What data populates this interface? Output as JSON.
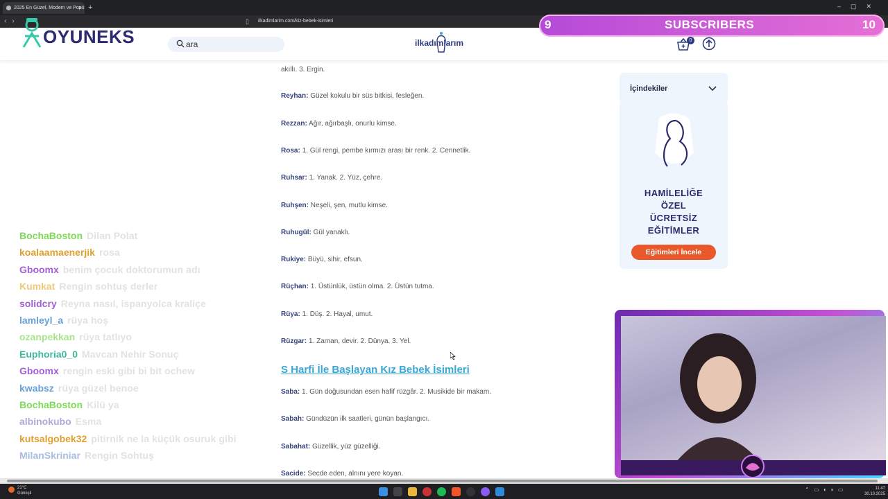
{
  "browser": {
    "tab_title": "2025 En Güzel, Modern ve Popü",
    "tab_close": "×",
    "new_tab": "+",
    "url": "ilkadimlarim.com/kiz-bebek-isimleri"
  },
  "site": {
    "logo": "OYUNEKS",
    "search_value": "ara",
    "center_logo": "ilkadımlarım",
    "cart_count": "0"
  },
  "subscribers": {
    "left_number": "9",
    "label": "SUBSCRIBERS",
    "right_number": "10"
  },
  "content": {
    "top_fragment": "akıllı. 3. Ergin.",
    "entries_r": [
      {
        "name": "Reyhan:",
        "meaning": "Güzel kokulu bir süs bitkisi, fesleğen."
      },
      {
        "name": "Rezzan:",
        "meaning": "Ağır, ağırbaşlı, onurlu kimse."
      },
      {
        "name": "Rosa:",
        "meaning": "1. Gül rengi, pembe kırmızı arası bir renk. 2. Cennetlik."
      },
      {
        "name": "Ruhsar:",
        "meaning": "1. Yanak. 2. Yüz, çehre."
      },
      {
        "name": "Ruhşen:",
        "meaning": "Neşeli, şen, mutlu kimse."
      },
      {
        "name": "Ruhugül:",
        "meaning": "Gül yanaklı."
      },
      {
        "name": "Rukiye:",
        "meaning": "Büyü, sihir, efsun."
      },
      {
        "name": "Rüçhan:",
        "meaning": "1. Üstünlük, üstün olma. 2. Üstün tutma."
      },
      {
        "name": "Rüya:",
        "meaning": "1. Düş. 2. Hayal, umut."
      },
      {
        "name": "Rüzgar:",
        "meaning": "1. Zaman, devir. 2. Dünya. 3. Yel."
      }
    ],
    "section_heading": "S Harfi İle Başlayan Kız Bebek İsimleri",
    "entries_s": [
      {
        "name": "Saba:",
        "meaning": "1. Gün doğusundan esen hafif rüzgâr. 2. Musikide bir makam."
      },
      {
        "name": "Sabah:",
        "meaning": "Gündüzün ilk saatleri, günün başlangıcı."
      },
      {
        "name": "Sabahat:",
        "meaning": "Güzellik, yüz güzelliği."
      },
      {
        "name": "Sacide:",
        "meaning": "Secde eden, alnını yere koyan."
      }
    ]
  },
  "sidebar": {
    "toc_label": "İçindekiler",
    "ad_lines": [
      "HAMİLELİĞE",
      "ÖZEL",
      "ÜCRETSİZ",
      "EĞİTİMLER"
    ],
    "ad_button": "Eğitimleri İncele"
  },
  "chat": [
    {
      "user": "BochaBoston",
      "msg": "Dilan Polat",
      "color": "#7ed957"
    },
    {
      "user": "koalaamaenerjik",
      "msg": "rosa",
      "color": "#e0a030"
    },
    {
      "user": "Gboomx",
      "msg": "benim çocuk doktorumun adı",
      "color": "#a35fd6"
    },
    {
      "user": "Kumkat",
      "msg": "Rengin sohtuş derler",
      "color": "#f0c878"
    },
    {
      "user": "solidcry",
      "msg": "Reyna nasıl, ispanyolca kraliçe",
      "color": "#a35fd6"
    },
    {
      "user": "lamleyl_a",
      "msg": "rüya hoş",
      "color": "#6aa0d8"
    },
    {
      "user": "ozanpekkan",
      "msg": "rüya tatlıyo",
      "color": "#a8e58c"
    },
    {
      "user": "Euphoria0_0",
      "msg": "Mavcan Nehir Sonuç",
      "color": "#3fb8a0"
    },
    {
      "user": "Gboomx",
      "msg": "rengin eski gibi bi bit ochew",
      "color": "#a35fd6"
    },
    {
      "user": "kwabsz",
      "msg": "rüya güzel benoe",
      "color": "#6aa0d8"
    },
    {
      "user": "BochaBoston",
      "msg": "Kilü ya",
      "color": "#7ed957"
    },
    {
      "user": "albinokubo",
      "msg": "Esma",
      "color": "#b0a8d8"
    },
    {
      "user": "kutsalgobek32",
      "msg": "pitirnik ne la küçük osuruk gibi",
      "color": "#e0a030"
    },
    {
      "user": "MilanSkriniar",
      "msg": "Rengin Sohtuş",
      "color": "#a8bde0"
    }
  ],
  "taskbar": {
    "weather_temp": "21°C",
    "weather_desc": "Güneşli",
    "time": "11:47",
    "date": "30.10.2025"
  },
  "colors": {
    "accent_blue": "#39a7d8",
    "name_color": "#36457a",
    "ad_button": "#e8582a",
    "subscriber_banner": "#c95ad8"
  }
}
